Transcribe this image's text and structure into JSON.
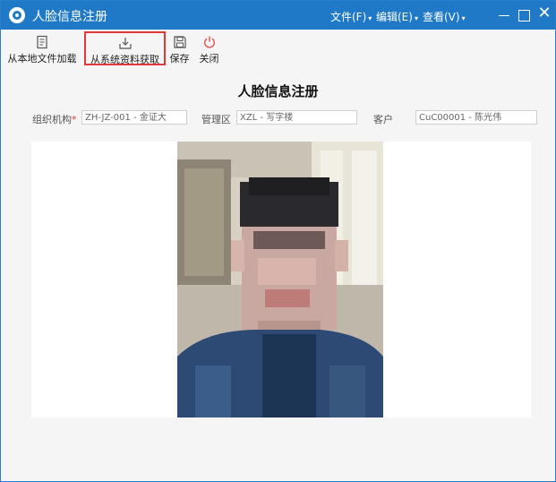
{
  "window": {
    "title": "人脸信息注册",
    "menus": [
      {
        "label": "文件(F)"
      },
      {
        "label": "编辑(E)"
      },
      {
        "label": "查看(V)"
      }
    ]
  },
  "toolbar": {
    "items": [
      {
        "label": "从本地文件加载",
        "icon": "file-load-icon"
      },
      {
        "label": "从系统资料获取",
        "icon": "download-icon",
        "selected": true
      },
      {
        "label": "保存",
        "icon": "save-icon"
      },
      {
        "label": "关闭",
        "icon": "power-icon"
      }
    ]
  },
  "form": {
    "title": "人脸信息注册",
    "org": {
      "label": "组织机构",
      "required_mark": "*",
      "value": "ZH-JZ-001 - 金证大"
    },
    "zone": {
      "label": "管理区",
      "value": "XZL - 写字楼"
    },
    "customer": {
      "label": "客户",
      "value": "CuC00001 - 陈光伟"
    }
  },
  "colors": {
    "titlebar": "#1f79c6",
    "highlight": "#e23838",
    "power_icon": "#e6433f"
  }
}
